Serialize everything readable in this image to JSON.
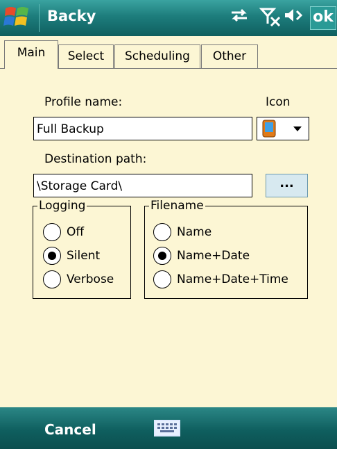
{
  "title_bar": {
    "app_title": "Backy",
    "ok_label": "ok",
    "icons": [
      "windows-start-icon",
      "sync-arrows-icon",
      "signal-off-icon",
      "volume-mute-icon"
    ]
  },
  "tabs": [
    {
      "label": "Main",
      "active": true
    },
    {
      "label": "Select",
      "active": false
    },
    {
      "label": "Scheduling",
      "active": false
    },
    {
      "label": "Other",
      "active": false
    }
  ],
  "main": {
    "profile_name_label": "Profile name:",
    "profile_name_value": "Full Backup",
    "icon_label": "Icon",
    "icon_value": "pda-icon",
    "destination_label": "Destination path:",
    "destination_value": "\\Storage Card\\",
    "browse_label": "...",
    "logging": {
      "legend": "Logging",
      "options": [
        "Off",
        "Silent",
        "Verbose"
      ],
      "selected": "Silent"
    },
    "filename": {
      "legend": "Filename",
      "options": [
        "Name",
        "Name+Date",
        "Name+Date+Time"
      ],
      "selected": "Name+Date"
    }
  },
  "bottom_bar": {
    "cancel_label": "Cancel",
    "keyboard_icon": "keyboard-icon"
  },
  "colors": {
    "teal": "#1d7d7c",
    "panel_bg": "#fcf6d4",
    "button_blue": "#d7e9f0"
  }
}
